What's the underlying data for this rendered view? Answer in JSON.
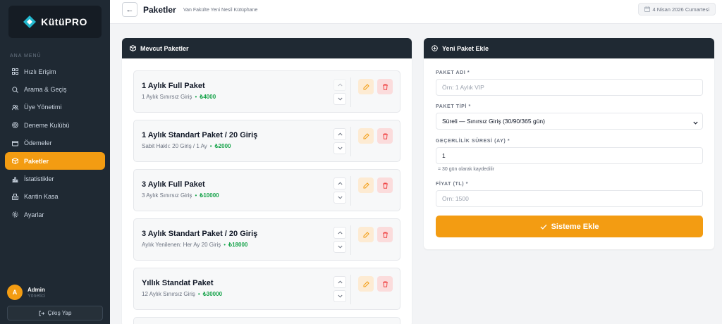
{
  "brand": {
    "name": "KütüPRO",
    "accent": "#f39c12"
  },
  "sidebar": {
    "menu_title": "ANA MENÜ",
    "items": [
      {
        "label": "Hızlı Erişim",
        "icon": "grid-icon"
      },
      {
        "label": "Arama & Geçiş",
        "icon": "search-icon"
      },
      {
        "label": "Üye Yönetimi",
        "icon": "users-icon"
      },
      {
        "label": "Deneme Kulübü",
        "icon": "target-icon"
      },
      {
        "label": "Ödemeler",
        "icon": "wallet-icon"
      },
      {
        "label": "Paketler",
        "icon": "box-icon",
        "active": true
      },
      {
        "label": "İstatistikler",
        "icon": "bar-chart-icon"
      },
      {
        "label": "Kantin Kasa",
        "icon": "cash-register-icon"
      },
      {
        "label": "Ayarlar",
        "icon": "gear-icon"
      }
    ],
    "user": {
      "initial": "A",
      "name": "Admin",
      "role": "Yönetici"
    },
    "logout_label": "Çıkış Yap"
  },
  "header": {
    "title": "Paketler",
    "subtitle": "Van Fakülte Yeni Nesil Kütüphane",
    "date": "4 Nisan 2026 Cumartesi"
  },
  "packages": {
    "title": "Mevcut Paketler",
    "items": [
      {
        "name": "1 Aylık Full Paket",
        "desc": "1 Aylık Sınırsız Giriş",
        "price": "₺4000"
      },
      {
        "name": "1 Aylık Standart Paket / 20 Giriş",
        "desc": "Sabit Haklı: 20 Giriş / 1 Ay",
        "price": "₺2000"
      },
      {
        "name": "3 Aylık Full Paket",
        "desc": "3 Aylık Sınırsız Giriş",
        "price": "₺10000"
      },
      {
        "name": "3 Aylık Standart Paket / 20 Giriş",
        "desc": "Aylık Yenilenen: Her Ay 20 Giriş",
        "price": "₺18000"
      },
      {
        "name": "Yıllık Standat Paket",
        "desc": "12 Aylık Sınırsız Giriş",
        "price": "₺30000"
      }
    ]
  },
  "form": {
    "title": "Yeni Paket Ekle",
    "name_label": "PAKET ADI *",
    "name_placeholder": "Örn: 1 Aylık VIP",
    "type_label": "PAKET TİPİ *",
    "type_value": "Süreli — Sınırsız Giriş (30/90/365 gün)",
    "validity_label": "GEÇERLİLİK SÜRESİ (AY) *",
    "validity_value": "1",
    "validity_hint": "= 30 gün olarak kaydedilir",
    "price_label": "FİYAT (TL) *",
    "price_placeholder": "Örn: 1500",
    "submit_label": "Sisteme Ekle"
  }
}
